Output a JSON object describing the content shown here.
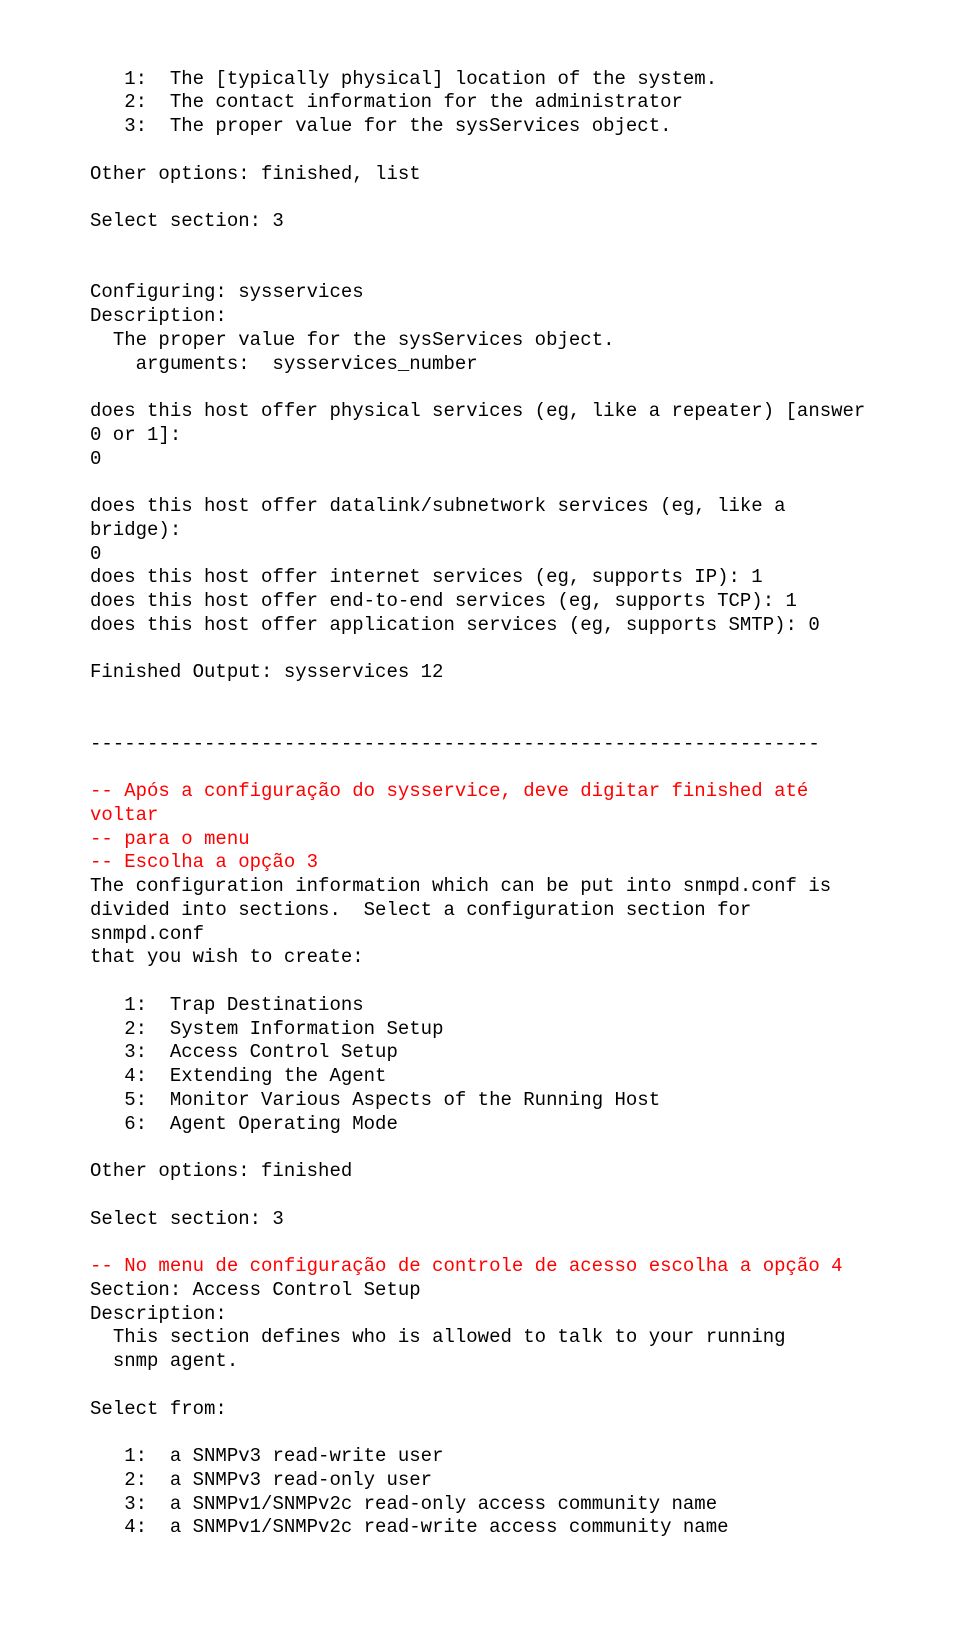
{
  "lines": [
    {
      "cls": "blk",
      "text": "   1:  The [typically physical] location of the system."
    },
    {
      "cls": "blk",
      "text": "   2:  The contact information for the administrator"
    },
    {
      "cls": "blk",
      "text": "   3:  The proper value for the sysServices object."
    },
    {
      "cls": "blk",
      "text": ""
    },
    {
      "cls": "blk",
      "text": "Other options: finished, list"
    },
    {
      "cls": "blk",
      "text": ""
    },
    {
      "cls": "blk",
      "text": "Select section: 3"
    },
    {
      "cls": "blk",
      "text": ""
    },
    {
      "cls": "blk",
      "text": ""
    },
    {
      "cls": "blk",
      "text": "Configuring: sysservices"
    },
    {
      "cls": "blk",
      "text": "Description:"
    },
    {
      "cls": "blk",
      "text": "  The proper value for the sysServices object."
    },
    {
      "cls": "blk",
      "text": "    arguments:  sysservices_number"
    },
    {
      "cls": "blk",
      "text": ""
    },
    {
      "cls": "blk",
      "text": "does this host offer physical services (eg, like a repeater) [answer 0 or 1]:"
    },
    {
      "cls": "blk",
      "text": "0"
    },
    {
      "cls": "blk",
      "text": ""
    },
    {
      "cls": "blk",
      "text": "does this host offer datalink/subnetwork services (eg, like a bridge):"
    },
    {
      "cls": "blk",
      "text": "0"
    },
    {
      "cls": "blk",
      "text": "does this host offer internet services (eg, supports IP): 1"
    },
    {
      "cls": "blk",
      "text": "does this host offer end-to-end services (eg, supports TCP): 1"
    },
    {
      "cls": "blk",
      "text": "does this host offer application services (eg, supports SMTP): 0"
    },
    {
      "cls": "blk",
      "text": ""
    },
    {
      "cls": "blk",
      "text": "Finished Output: sysservices 12"
    },
    {
      "cls": "blk",
      "text": ""
    },
    {
      "cls": "blk",
      "text": ""
    },
    {
      "cls": "blk",
      "text": "----------------------------------------------------------------"
    },
    {
      "cls": "blk",
      "text": ""
    },
    {
      "cls": "red",
      "text": "-- Após a configuração do sysservice, deve digitar finished até voltar"
    },
    {
      "cls": "red",
      "text": "-- para o menu "
    },
    {
      "cls": "red",
      "text": "-- Escolha a opção 3"
    },
    {
      "cls": "blk",
      "text": "The configuration information which can be put into snmpd.conf is"
    },
    {
      "cls": "blk",
      "text": "divided into sections.  Select a configuration section for snmpd.conf"
    },
    {
      "cls": "blk",
      "text": "that you wish to create:"
    },
    {
      "cls": "blk",
      "text": ""
    },
    {
      "cls": "blk",
      "text": "   1:  Trap Destinations"
    },
    {
      "cls": "blk",
      "text": "   2:  System Information Setup"
    },
    {
      "cls": "blk",
      "text": "   3:  Access Control Setup"
    },
    {
      "cls": "blk",
      "text": "   4:  Extending the Agent"
    },
    {
      "cls": "blk",
      "text": "   5:  Monitor Various Aspects of the Running Host"
    },
    {
      "cls": "blk",
      "text": "   6:  Agent Operating Mode"
    },
    {
      "cls": "blk",
      "text": ""
    },
    {
      "cls": "blk",
      "text": "Other options: finished"
    },
    {
      "cls": "blk",
      "text": ""
    },
    {
      "cls": "blk",
      "text": "Select section: 3"
    },
    {
      "cls": "blk",
      "text": ""
    },
    {
      "cls": "red",
      "text": "-- No menu de configuração de controle de acesso escolha a opção 4"
    },
    {
      "cls": "blk",
      "text": "Section: Access Control Setup"
    },
    {
      "cls": "blk",
      "text": "Description:"
    },
    {
      "cls": "blk",
      "text": "  This section defines who is allowed to talk to your running"
    },
    {
      "cls": "blk",
      "text": "  snmp agent."
    },
    {
      "cls": "blk",
      "text": ""
    },
    {
      "cls": "blk",
      "text": "Select from:"
    },
    {
      "cls": "blk",
      "text": ""
    },
    {
      "cls": "blk",
      "text": "   1:  a SNMPv3 read-write user"
    },
    {
      "cls": "blk",
      "text": "   2:  a SNMPv3 read-only user"
    },
    {
      "cls": "blk",
      "text": "   3:  a SNMPv1/SNMPv2c read-only access community name"
    },
    {
      "cls": "blk",
      "text": "   4:  a SNMPv1/SNMPv2c read-write access community name"
    }
  ]
}
